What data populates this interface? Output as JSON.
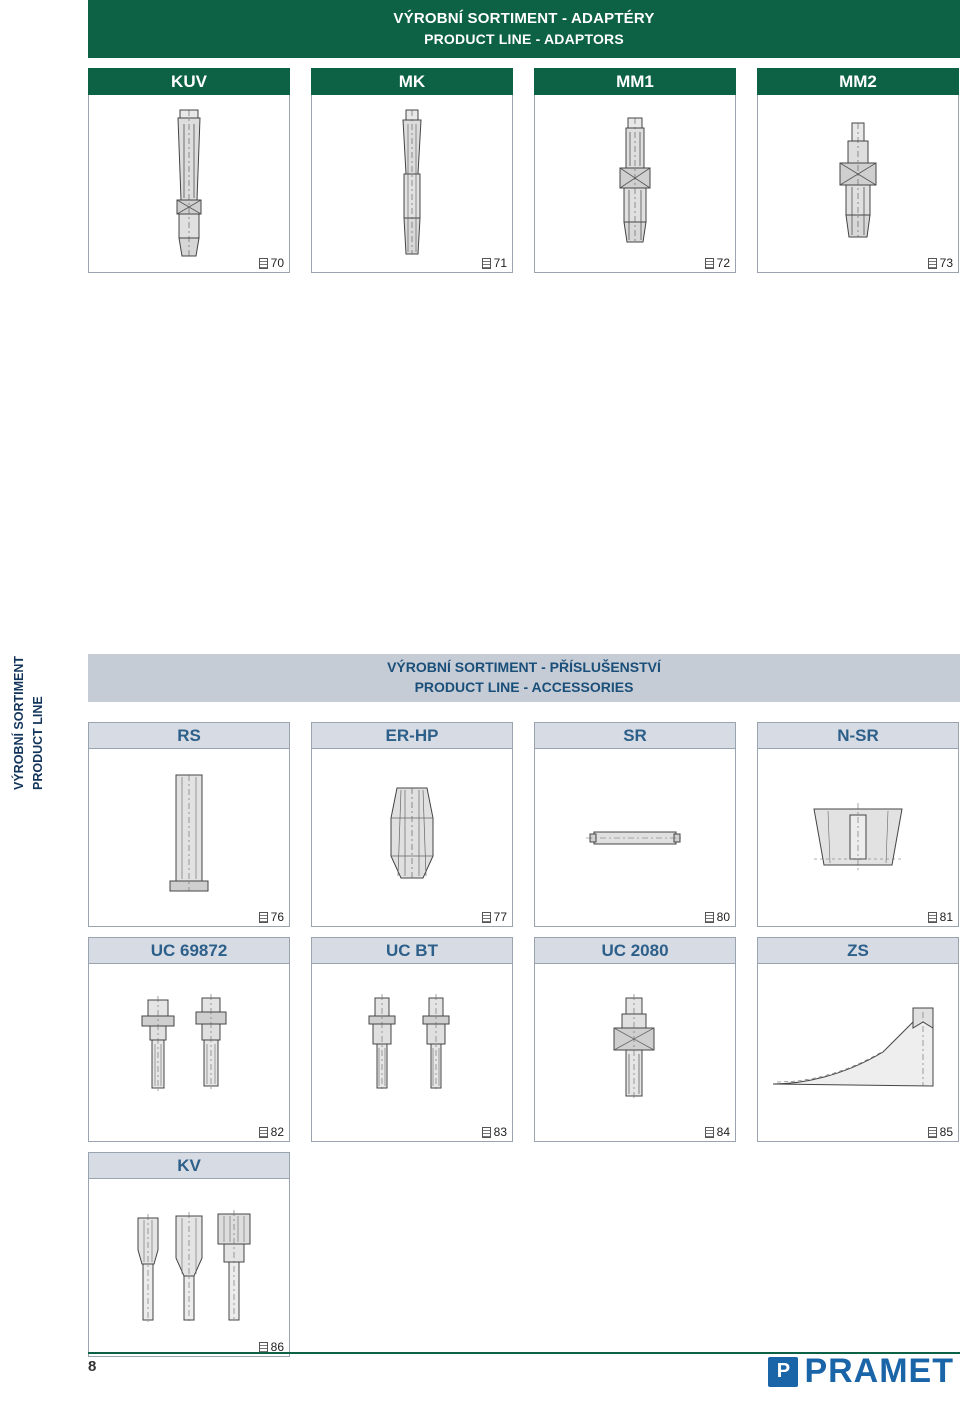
{
  "header": {
    "title_cs": "VÝROBNÍ SORTIMENT - ADAPTÉRY",
    "title_en": "PRODUCT LINE - ADAPTORS"
  },
  "side_tab": {
    "line1": "VÝROBNÍ SORTIMENT",
    "line2": "PRODUCT LINE"
  },
  "accessories_bar": {
    "title_cs": "VÝROBNÍ SORTIMENT - PŘÍSLUŠENSTVÍ",
    "title_en": "PRODUCT LINE - ACCESSORIES"
  },
  "adaptors": [
    {
      "label": "KUV",
      "page": "70",
      "icon": "adaptor-kuv-drawing"
    },
    {
      "label": "MK",
      "page": "71",
      "icon": "adaptor-mk-drawing"
    },
    {
      "label": "MM1",
      "page": "72",
      "icon": "adaptor-mm1-drawing"
    },
    {
      "label": "MM2",
      "page": "73",
      "icon": "adaptor-mm2-drawing"
    }
  ],
  "accessories_row1": [
    {
      "label": "RS",
      "page": "76",
      "icon": "accessory-rs-drawing"
    },
    {
      "label": "ER-HP",
      "page": "77",
      "icon": "accessory-erhp-drawing"
    },
    {
      "label": "SR",
      "page": "80",
      "icon": "accessory-sr-drawing"
    },
    {
      "label": "N-SR",
      "page": "81",
      "icon": "accessory-nsr-drawing"
    }
  ],
  "accessories_row2": [
    {
      "label": "UC 69872",
      "page": "82",
      "icon": "accessory-uc69872-drawing"
    },
    {
      "label": "UC BT",
      "page": "83",
      "icon": "accessory-ucbt-drawing"
    },
    {
      "label": "UC 2080",
      "page": "84",
      "icon": "accessory-uc2080-drawing"
    },
    {
      "label": "ZS",
      "page": "85",
      "icon": "accessory-zs-drawing"
    }
  ],
  "accessories_row3": [
    {
      "label": "KV",
      "page": "86",
      "icon": "accessory-kv-drawing"
    }
  ],
  "footer": {
    "page_number": "8",
    "logo_text": "PRAMET",
    "logo_mark": "P"
  },
  "colors": {
    "green": "#0d6246",
    "banner_grey": "#c6ccd6",
    "cap_grey": "#d9dde5",
    "blue_text": "#2c5f8a",
    "logo_blue": "#1a64a8"
  }
}
